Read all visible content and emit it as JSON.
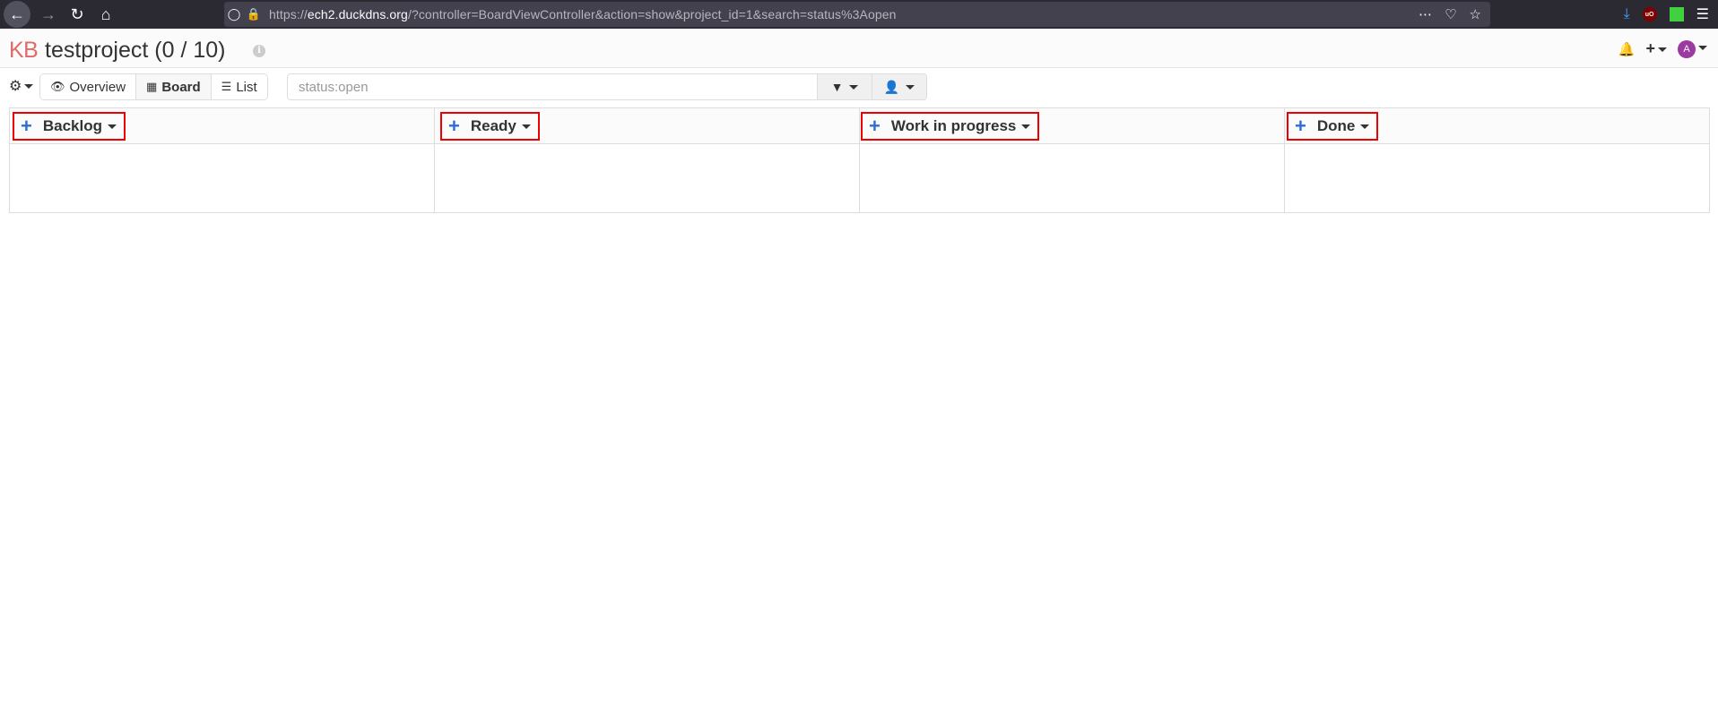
{
  "browser": {
    "url_prefix": "https://",
    "url_host": "ech2.duckdns.org",
    "url_path": "/?controller=BoardViewController&action=show&project_id=1&search=status%3Aopen"
  },
  "header": {
    "logo": "KB",
    "title": "testproject (0 / 10)",
    "avatar_letter": "A"
  },
  "toolbar": {
    "views": [
      {
        "label": "Overview",
        "icon": "eye-icon"
      },
      {
        "label": "Board",
        "icon": "grid-icon",
        "active": true
      },
      {
        "label": "List",
        "icon": "list-icon"
      }
    ],
    "search_value": "status:open"
  },
  "board": {
    "columns": [
      {
        "title": "Backlog"
      },
      {
        "title": "Ready"
      },
      {
        "title": "Work in progress"
      },
      {
        "title": "Done"
      }
    ]
  },
  "colors": {
    "accent_blue": "#2e6dd6",
    "highlight_red": "#e00000",
    "logo_red": "#d9534f",
    "avatar_purple": "#9b3aa0"
  }
}
